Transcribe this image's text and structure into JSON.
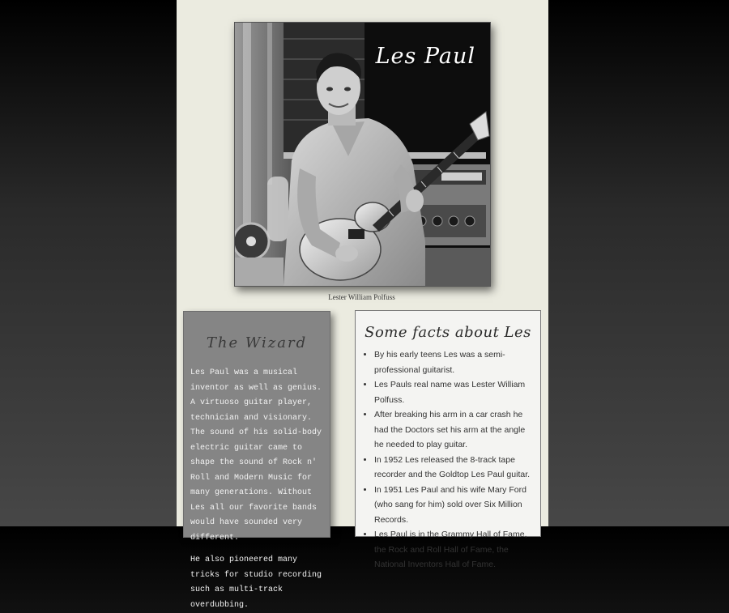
{
  "photo": {
    "title": "Les Paul",
    "caption": "Lester William Polfuss",
    "alt": "Les Paul holding a Goldtop guitar in a recording studio"
  },
  "wizard": {
    "heading": "The  Wizard",
    "paragraphs": [
      "Les Paul was a musical inventor as well as genius. A virtuoso guitar player, technician and visionary. The sound of his solid-body electric guitar came to shape the sound of Rock n' Roll and Modern Music for many generations. Without Les all our favorite bands would have sounded very different.",
      "He also pioneered many tricks for studio recording such as multi-track overdubbing."
    ]
  },
  "facts": {
    "heading": "Some facts about  Les",
    "items": [
      "By his early teens Les was a semi-professional guitarist.",
      "Les Pauls real name was Lester William Polfuss.",
      "After breaking his arm in a car crash he had the Doctors set his arm at the angle he needed to play guitar.",
      "In 1952 Les released the 8-track tape recorder and the Goldtop Les Paul guitar.",
      "In 1951 Les Paul and his wife Mary Ford (who sang for him) sold over Six Million Records.",
      "Les Paul is in the Grammy Hall of Fame, the Rock and Roll Hall of Fame, the National Inventors Hall of Fame."
    ]
  }
}
